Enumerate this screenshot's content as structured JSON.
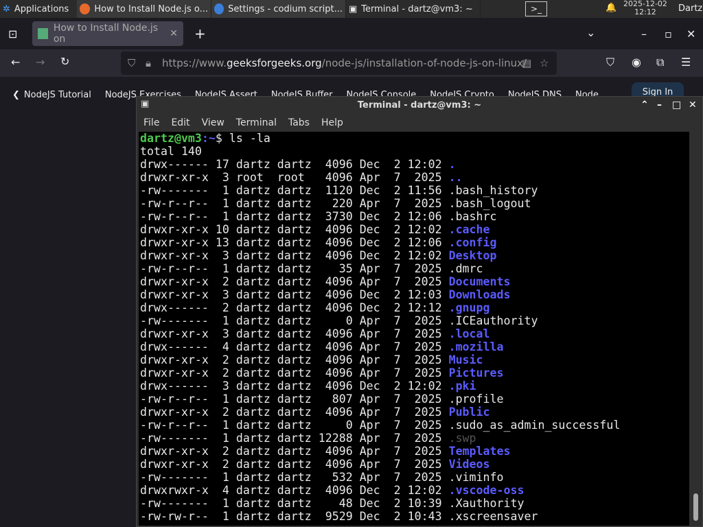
{
  "taskbar": {
    "applications": "Applications",
    "tasks": [
      {
        "label": "How to Install Node.js o...",
        "icon": "firefox-icon"
      },
      {
        "label": "Settings - codium script...",
        "icon": "settings-icon"
      },
      {
        "label": "Terminal - dartz@vm3: ~",
        "icon": "terminal-icon"
      }
    ],
    "date": "2025-12-02",
    "time": "12:12",
    "user": "Dartz"
  },
  "browser": {
    "tab_title": "How to Install Node.js on",
    "url_prefix": "https://www.",
    "url_domain": "geeksforgeeks.org",
    "url_path": "/node-js/installation-of-node-js-on-linux/",
    "bookmarks": [
      "NodeJS Tutorial",
      "NodeJS Exercises",
      "NodeJS Assert",
      "NodeJS Buffer",
      "NodeJS Console",
      "NodeJS Crypto",
      "NodeJS DNS",
      "Node"
    ],
    "sign_in": "Sign In"
  },
  "terminal": {
    "title": "Terminal - dartz@vm3: ~",
    "menu": [
      "File",
      "Edit",
      "View",
      "Terminal",
      "Tabs",
      "Help"
    ],
    "prompt_user": "dartz@vm3",
    "prompt_path": ":~",
    "prompt_symbol": "$ ",
    "command": "ls -la",
    "total": "total 140",
    "entries": [
      [
        "drwx------",
        "17",
        "dartz",
        "dartz",
        "4096",
        "Dec",
        "2",
        "12:02",
        ".",
        "dir"
      ],
      [
        "drwxr-xr-x",
        "3",
        "root",
        "root",
        "4096",
        "Apr",
        "7",
        "2025",
        "..",
        "dir"
      ],
      [
        "-rw-------",
        "1",
        "dartz",
        "dartz",
        "1120",
        "Dec",
        "2",
        "11:56",
        ".bash_history",
        "file"
      ],
      [
        "-rw-r--r--",
        "1",
        "dartz",
        "dartz",
        "220",
        "Apr",
        "7",
        "2025",
        ".bash_logout",
        "file"
      ],
      [
        "-rw-r--r--",
        "1",
        "dartz",
        "dartz",
        "3730",
        "Dec",
        "2",
        "12:06",
        ".bashrc",
        "file"
      ],
      [
        "drwxr-xr-x",
        "10",
        "dartz",
        "dartz",
        "4096",
        "Dec",
        "2",
        "12:02",
        ".cache",
        "dir"
      ],
      [
        "drwxr-xr-x",
        "13",
        "dartz",
        "dartz",
        "4096",
        "Dec",
        "2",
        "12:06",
        ".config",
        "dir"
      ],
      [
        "drwxr-xr-x",
        "3",
        "dartz",
        "dartz",
        "4096",
        "Dec",
        "2",
        "12:02",
        "Desktop",
        "dir"
      ],
      [
        "-rw-r--r--",
        "1",
        "dartz",
        "dartz",
        "35",
        "Apr",
        "7",
        "2025",
        ".dmrc",
        "file"
      ],
      [
        "drwxr-xr-x",
        "2",
        "dartz",
        "dartz",
        "4096",
        "Apr",
        "7",
        "2025",
        "Documents",
        "dir"
      ],
      [
        "drwxr-xr-x",
        "3",
        "dartz",
        "dartz",
        "4096",
        "Dec",
        "2",
        "12:03",
        "Downloads",
        "dir"
      ],
      [
        "drwx------",
        "2",
        "dartz",
        "dartz",
        "4096",
        "Dec",
        "2",
        "12:12",
        ".gnupg",
        "dir"
      ],
      [
        "-rw-------",
        "1",
        "dartz",
        "dartz",
        "0",
        "Apr",
        "7",
        "2025",
        ".ICEauthority",
        "file"
      ],
      [
        "drwxr-xr-x",
        "3",
        "dartz",
        "dartz",
        "4096",
        "Apr",
        "7",
        "2025",
        ".local",
        "dir"
      ],
      [
        "drwx------",
        "4",
        "dartz",
        "dartz",
        "4096",
        "Apr",
        "7",
        "2025",
        ".mozilla",
        "dir"
      ],
      [
        "drwxr-xr-x",
        "2",
        "dartz",
        "dartz",
        "4096",
        "Apr",
        "7",
        "2025",
        "Music",
        "dir"
      ],
      [
        "drwxr-xr-x",
        "2",
        "dartz",
        "dartz",
        "4096",
        "Apr",
        "7",
        "2025",
        "Pictures",
        "dir"
      ],
      [
        "drwx------",
        "3",
        "dartz",
        "dartz",
        "4096",
        "Dec",
        "2",
        "12:02",
        ".pki",
        "dir"
      ],
      [
        "-rw-r--r--",
        "1",
        "dartz",
        "dartz",
        "807",
        "Apr",
        "7",
        "2025",
        ".profile",
        "file"
      ],
      [
        "drwxr-xr-x",
        "2",
        "dartz",
        "dartz",
        "4096",
        "Apr",
        "7",
        "2025",
        "Public",
        "dir"
      ],
      [
        "-rw-r--r--",
        "1",
        "dartz",
        "dartz",
        "0",
        "Apr",
        "7",
        "2025",
        ".sudo_as_admin_successful",
        "file"
      ],
      [
        "-rw-------",
        "1",
        "dartz",
        "dartz",
        "12288",
        "Apr",
        "7",
        "2025",
        ".swp",
        "gray"
      ],
      [
        "drwxr-xr-x",
        "2",
        "dartz",
        "dartz",
        "4096",
        "Apr",
        "7",
        "2025",
        "Templates",
        "dir"
      ],
      [
        "drwxr-xr-x",
        "2",
        "dartz",
        "dartz",
        "4096",
        "Apr",
        "7",
        "2025",
        "Videos",
        "dir"
      ],
      [
        "-rw-------",
        "1",
        "dartz",
        "dartz",
        "532",
        "Apr",
        "7",
        "2025",
        ".viminfo",
        "file"
      ],
      [
        "drwxrwxr-x",
        "4",
        "dartz",
        "dartz",
        "4096",
        "Dec",
        "2",
        "12:02",
        ".vscode-oss",
        "dir"
      ],
      [
        "-rw-------",
        "1",
        "dartz",
        "dartz",
        "48",
        "Dec",
        "2",
        "10:39",
        ".Xauthority",
        "file"
      ],
      [
        "-rw-rw-r--",
        "1",
        "dartz",
        "dartz",
        "9529",
        "Dec",
        "2",
        "10:43",
        ".xscreensaver",
        "file"
      ]
    ],
    "colors": {
      "prompt": "#4ec94e",
      "directory": "#5b5bff",
      "background": "#000000"
    }
  }
}
